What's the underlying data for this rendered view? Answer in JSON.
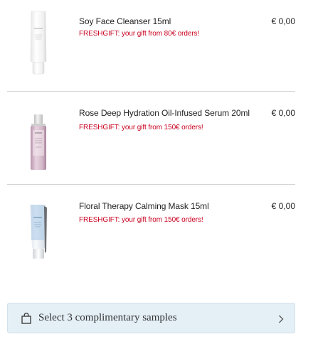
{
  "cart": {
    "items": [
      {
        "name": "Soy Face Cleanser 15ml",
        "promo": "FRESHGIFT: your gift from 80€ orders!",
        "price": "€ 0,00",
        "image_icon": "cleanser-tube-icon",
        "brand_mark": "fresh"
      },
      {
        "name": "Rose Deep Hydration Oil-Infused Serum 20ml",
        "promo": "FRESHGIFT: your gift from 150€ orders!",
        "price": "€ 0,00",
        "image_icon": "serum-bottle-icon",
        "brand_mark": "fresh"
      },
      {
        "name": "Floral Therapy Calming Mask 15ml",
        "promo": "FRESHGIFT: your gift from 150€ orders!",
        "price": "€ 0,00",
        "image_icon": "mask-tube-icon",
        "brand_mark": "fresh"
      }
    ]
  },
  "samples": {
    "label": "Select 3 complimentary samples",
    "icon": "shopping-bag-icon",
    "chevron": "chevron-right-icon"
  },
  "colors": {
    "promo_text": "#c8001e",
    "button_bg": "#e4eff6",
    "divider": "#d4d4d4"
  }
}
